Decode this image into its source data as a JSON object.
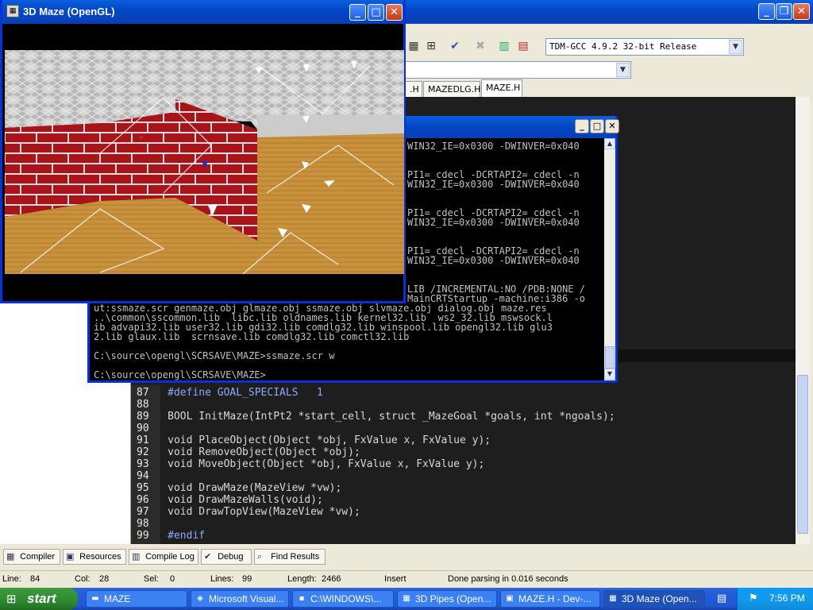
{
  "ide": {
    "compiler_select": "TDM-GCC 4.9.2 32-bit Release",
    "second_select": "",
    "file_tabs": [
      ".H",
      "MAZEDLG.H",
      "MAZE.H"
    ],
    "code_lines": [
      {
        "num": "87",
        "text": "#define GOAL_SPECIALS   1"
      },
      {
        "num": "88",
        "text": ""
      },
      {
        "num": "89",
        "text": "BOOL InitMaze(IntPt2 *start_cell, struct _MazeGoal *goals, int *ngoals);"
      },
      {
        "num": "90",
        "text": ""
      },
      {
        "num": "91",
        "text": "void PlaceObject(Object *obj, FxValue x, FxValue y);"
      },
      {
        "num": "92",
        "text": "void RemoveObject(Object *obj);"
      },
      {
        "num": "93",
        "text": "void MoveObject(Object *obj, FxValue x, FxValue y);"
      },
      {
        "num": "94",
        "text": ""
      },
      {
        "num": "95",
        "text": "void DrawMaze(MazeView *vw);"
      },
      {
        "num": "96",
        "text": "void DrawMazeWalls(void);"
      },
      {
        "num": "97",
        "text": "void DrawTopView(MazeView *vw);"
      },
      {
        "num": "98",
        "text": ""
      },
      {
        "num": "99",
        "text": "#endif"
      }
    ],
    "bottom_tabs": [
      "Compiler",
      "Resources",
      "Compile Log",
      "Debug",
      "Find Results"
    ],
    "status": {
      "line_label": "Line:",
      "line_value": "84",
      "col_label": "Col:",
      "col_value": "28",
      "sel_label": "Sel:",
      "sel_value": "0",
      "lines_label": "Lines:",
      "lines_value": "99",
      "length_label": "Length:",
      "length_value": "2466",
      "mode": "Insert",
      "message": "Done parsing in 0.016 seconds"
    }
  },
  "console": {
    "lines": [
      "WIN32_IE=0x0300 -DWINVER=0x040",
      "",
      "PI1=_cdecl -DCRTAPI2=_cdecl -n",
      "WIN32_IE=0x0300 -DWINVER=0x040",
      "",
      "PI1=_cdecl -DCRTAPI2=_cdecl -n",
      "WIN32_IE=0x0300 -DWINVER=0x040",
      "",
      "PI1=_cdecl -DCRTAPI2=_cdecl -n",
      "WIN32_IE=0x0300 -DWINVER=0x040",
      "",
      "LIB /INCREMENTAL:NO /PDB:NONE /",
      "MainCRTStartup -machine:i386 -o",
      "ut:ssmaze.scr genmaze.obj glmaze.obj ssmaze.obj slvmaze.obj dialog.obj maze.res",
      "..\\common\\sscommon.lib  libc.lib oldnames.lib kernel32.lib  ws2_32.lib mswsock.l",
      "ib advapi32.lib user32.lib gdi32.lib comdlg32.lib winspool.lib opengl32.lib glu3",
      "2.lib glaux.lib  scrnsave.lib comdlg32.lib comctl32.lib",
      "",
      "C:\\source\\opengl\\SCRSAVE\\MAZE>ssmaze.scr w",
      "",
      "C:\\source\\opengl\\SCRSAVE\\MAZE>"
    ]
  },
  "maze_window": {
    "title": "3D Maze (OpenGL)"
  },
  "taskbar": {
    "start_label": "start",
    "tasks": [
      "MAZE",
      "Microsoft Visual...",
      "C:\\WINDOWS\\...",
      "3D Pipes (Open...",
      "MAZE.H - Dev-...",
      "3D Maze (Open..."
    ],
    "clock": "7:56 PM"
  },
  "colors": {
    "xp_blue": "#0a3fb8",
    "taskbar": "#245edb",
    "start_green": "#2f8a2f",
    "editor_bg": "#1e1e1e",
    "brick_red": "#a8141a",
    "floor_tan": "#c8913c"
  },
  "icons": [
    "maze-app-icon",
    "minimize-icon",
    "maximize-icon",
    "close-icon",
    "compiler-icon",
    "resources-icon",
    "compile-log-icon",
    "debug-icon",
    "find-icon",
    "windows-flag-icon",
    "folder-icon",
    "console-icon"
  ]
}
